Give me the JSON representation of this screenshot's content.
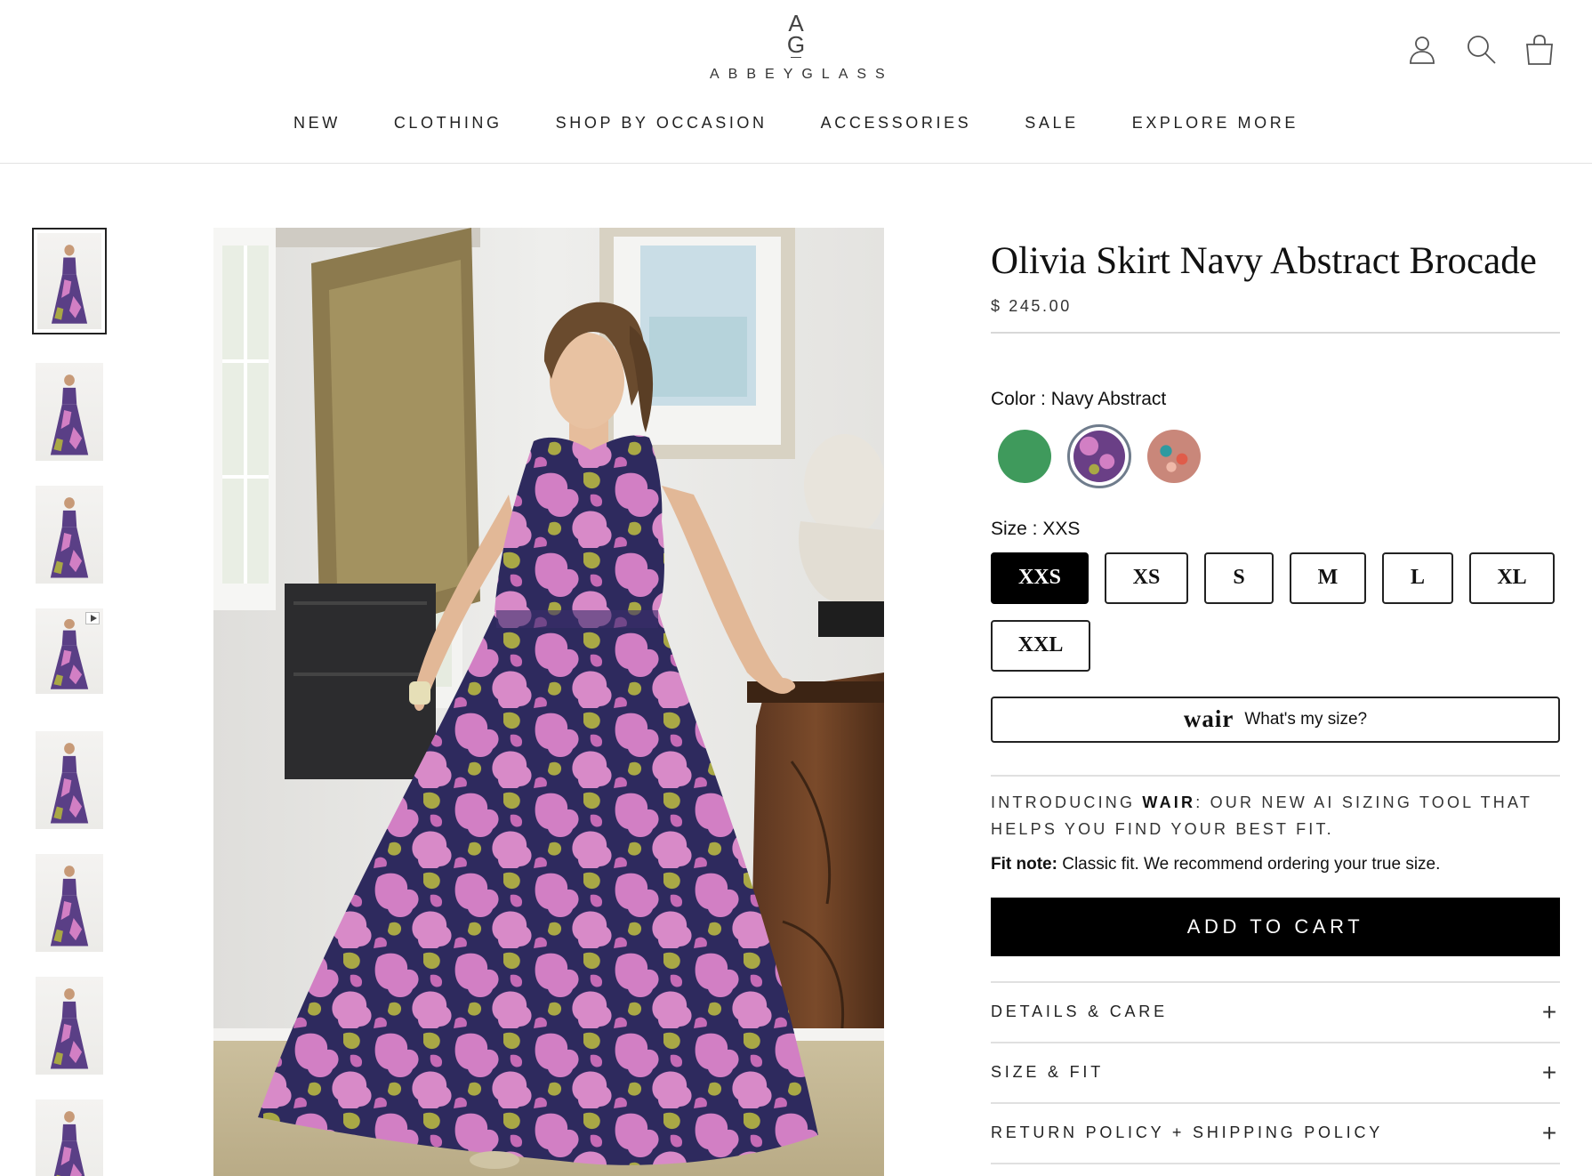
{
  "header": {
    "logo_mark_top": "A",
    "logo_mark_bottom": "G",
    "logo_text": "ABBEYGLASS",
    "icons": [
      "account-icon",
      "search-icon",
      "cart-icon"
    ]
  },
  "nav": {
    "items": [
      "NEW",
      "CLOTHING",
      "SHOP BY OCCASION",
      "ACCESSORIES",
      "SALE",
      "EXPLORE MORE"
    ]
  },
  "gallery": {
    "thumbnail_count": 8,
    "active_index": 0,
    "video_thumbnail_index": 3
  },
  "product": {
    "title": "Olivia Skirt Navy Abstract Brocade",
    "price": "$ 245.00",
    "color_label": "Color : ",
    "color_value": "Navy Abstract",
    "swatches": [
      {
        "name": "green",
        "color": "#3f9a5c"
      },
      {
        "name": "navy-abstract",
        "color": "#6a3f86",
        "selected": true
      },
      {
        "name": "coral-pattern",
        "color": "#c9877a"
      }
    ],
    "size_label": "Size : ",
    "size_value": "XXS",
    "sizes": [
      "XXS",
      "XS",
      "S",
      "M",
      "L",
      "XL",
      "XXL"
    ],
    "selected_size": "XXS",
    "wair_logo": "wair",
    "wair_text": "What's my size?",
    "intro_prefix": "INTRODUCING ",
    "intro_bold": "WAIR",
    "intro_suffix": ": OUR NEW AI SIZING TOOL THAT HELPS YOU FIND YOUR BEST FIT.",
    "fit_note_label": "Fit note:",
    "fit_note_text": " Classic fit. We recommend ordering your true size.",
    "add_to_cart": "ADD TO CART",
    "accordions": [
      "DETAILS & CARE",
      "SIZE & FIT",
      "RETURN POLICY + SHIPPING POLICY"
    ],
    "accordion_icon": "plus-icon"
  },
  "colors": {
    "accent": "#000000",
    "dress_navy": "#2e2a5e",
    "dress_pink": "#d27fc4",
    "dress_olive": "#a9a845"
  }
}
